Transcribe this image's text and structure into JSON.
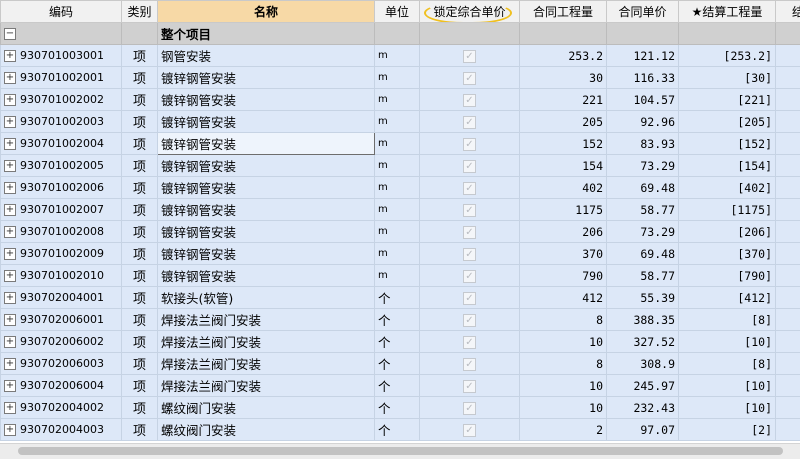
{
  "columns": [
    {
      "label": "编码"
    },
    {
      "label": "类别"
    },
    {
      "label": "名称"
    },
    {
      "label": "单位"
    },
    {
      "label": "锁定综合单价"
    },
    {
      "label": "合同工程量"
    },
    {
      "label": "合同单价"
    },
    {
      "label": "★结算工程量"
    },
    {
      "label": "结"
    }
  ],
  "sorted_column": "名称",
  "highlighted_column": "锁定综合单价",
  "group": {
    "expander": "−",
    "title": "整个项目"
  },
  "rows": [
    {
      "code": "930701003001",
      "type": "项",
      "name": "钢管安装",
      "unit": "m",
      "qty": "253.2",
      "price": "121.12",
      "settle": "[253.2]"
    },
    {
      "code": "930701002001",
      "type": "项",
      "name": "镀锌钢管安装",
      "unit": "m",
      "qty": "30",
      "price": "116.33",
      "settle": "[30]"
    },
    {
      "code": "930701002002",
      "type": "项",
      "name": "镀锌钢管安装",
      "unit": "m",
      "qty": "221",
      "price": "104.57",
      "settle": "[221]"
    },
    {
      "code": "930701002003",
      "type": "项",
      "name": "镀锌钢管安装",
      "unit": "m",
      "qty": "205",
      "price": "92.96",
      "settle": "[205]"
    },
    {
      "code": "930701002004",
      "type": "项",
      "name": "镀锌钢管安装",
      "unit": "m",
      "qty": "152",
      "price": "83.93",
      "settle": "[152]"
    },
    {
      "code": "930701002005",
      "type": "项",
      "name": "镀锌钢管安装",
      "unit": "m",
      "qty": "154",
      "price": "73.29",
      "settle": "[154]"
    },
    {
      "code": "930701002006",
      "type": "项",
      "name": "镀锌钢管安装",
      "unit": "m",
      "qty": "402",
      "price": "69.48",
      "settle": "[402]"
    },
    {
      "code": "930701002007",
      "type": "项",
      "name": "镀锌钢管安装",
      "unit": "m",
      "qty": "1175",
      "price": "58.77",
      "settle": "[1175]"
    },
    {
      "code": "930701002008",
      "type": "项",
      "name": "镀锌钢管安装",
      "unit": "m",
      "qty": "206",
      "price": "73.29",
      "settle": "[206]"
    },
    {
      "code": "930701002009",
      "type": "项",
      "name": "镀锌钢管安装",
      "unit": "m",
      "qty": "370",
      "price": "69.48",
      "settle": "[370]"
    },
    {
      "code": "930701002010",
      "type": "项",
      "name": "镀锌钢管安装",
      "unit": "m",
      "qty": "790",
      "price": "58.77",
      "settle": "[790]"
    },
    {
      "code": "930702004001",
      "type": "项",
      "name": "软接头(软管)",
      "unit": "个",
      "qty": "412",
      "price": "55.39",
      "settle": "[412]"
    },
    {
      "code": "930702006001",
      "type": "项",
      "name": "焊接法兰阀门安装",
      "unit": "个",
      "qty": "8",
      "price": "388.35",
      "settle": "[8]"
    },
    {
      "code": "930702006002",
      "type": "项",
      "name": "焊接法兰阀门安装",
      "unit": "个",
      "qty": "10",
      "price": "327.52",
      "settle": "[10]"
    },
    {
      "code": "930702006003",
      "type": "项",
      "name": "焊接法兰阀门安装",
      "unit": "个",
      "qty": "8",
      "price": "308.9",
      "settle": "[8]"
    },
    {
      "code": "930702006004",
      "type": "项",
      "name": "焊接法兰阀门安装",
      "unit": "个",
      "qty": "10",
      "price": "245.97",
      "settle": "[10]"
    },
    {
      "code": "930702004002",
      "type": "项",
      "name": "螺纹阀门安装",
      "unit": "个",
      "qty": "10",
      "price": "232.43",
      "settle": "[10]"
    },
    {
      "code": "930702004003",
      "type": "项",
      "name": "螺纹阀门安装",
      "unit": "个",
      "qty": "2",
      "price": "97.07",
      "settle": "[2]"
    }
  ],
  "expander_symbol": "+",
  "lock_checkbox": {
    "checked": true,
    "disabled": true,
    "glyph": "✓"
  },
  "colors": {
    "row_bg": "#dde8f8",
    "group_bg": "#d0d0d0",
    "sorted_header": "#f7d9a6",
    "annotation": "#f0c020"
  }
}
